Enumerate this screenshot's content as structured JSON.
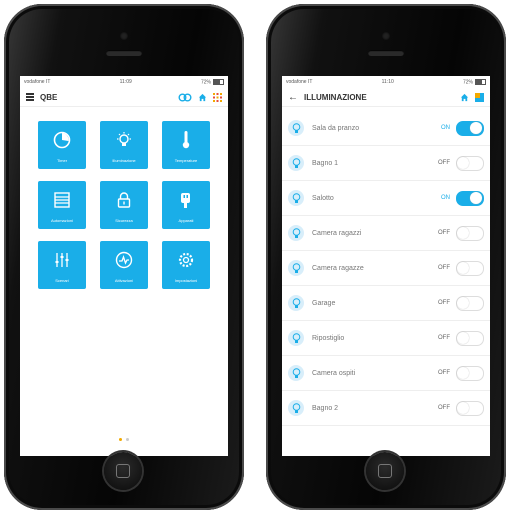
{
  "colors": {
    "accent": "#1aaee8",
    "brand_orange": "#f2a900",
    "home_icon": "#1aaee8"
  },
  "left_phone": {
    "status": {
      "carrier": "vodafone IT",
      "time": "11:09",
      "battery": "72%"
    },
    "navbar": {
      "title": "QBE",
      "icons": [
        "menu-icon",
        "cloud-link-icon",
        "home-icon",
        "grid-icon"
      ]
    },
    "tiles": [
      {
        "label": "Timer",
        "icon": "clock-icon"
      },
      {
        "label": "Illuminazione",
        "icon": "lightbulb-icon"
      },
      {
        "label": "Temperature",
        "icon": "thermometer-icon"
      },
      {
        "label": "Automazioni",
        "icon": "shutter-icon"
      },
      {
        "label": "Sicurezza",
        "icon": "lock-icon"
      },
      {
        "label": "Apparati",
        "icon": "plug-icon"
      },
      {
        "label": "Scenari",
        "icon": "sliders-icon"
      },
      {
        "label": "Attivazioni",
        "icon": "activity-icon"
      },
      {
        "label": "Impostazioni",
        "icon": "settings-icon"
      }
    ]
  },
  "right_phone": {
    "status": {
      "carrier": "vodafone IT",
      "time": "11:10",
      "battery": "72%"
    },
    "navbar": {
      "back_label": "←",
      "title": "ILLUMINAZIONE",
      "icons": [
        "home-icon",
        "brand-icon"
      ]
    },
    "rows": [
      {
        "label": "Sala da pranzo",
        "state": "ON",
        "on": true
      },
      {
        "label": "Bagno 1",
        "state": "OFF",
        "on": false
      },
      {
        "label": "Salotto",
        "state": "ON",
        "on": true
      },
      {
        "label": "Camera ragazzi",
        "state": "OFF",
        "on": false
      },
      {
        "label": "Camera ragazze",
        "state": "OFF",
        "on": false
      },
      {
        "label": "Garage",
        "state": "OFF",
        "on": false
      },
      {
        "label": "Ripostiglio",
        "state": "OFF",
        "on": false
      },
      {
        "label": "Camera ospiti",
        "state": "OFF",
        "on": false
      },
      {
        "label": "Bagno 2",
        "state": "OFF",
        "on": false
      }
    ]
  }
}
